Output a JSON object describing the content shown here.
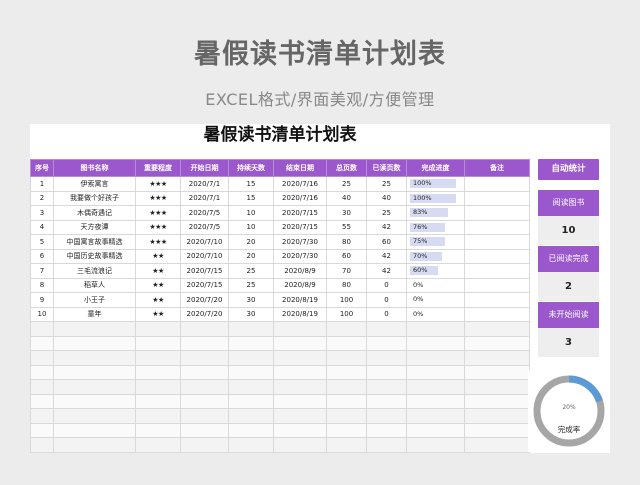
{
  "header": {
    "title": "暑假读书清单计划表",
    "subtitle": "EXCEL格式/界面美观/方便管理"
  },
  "sheet": {
    "title": "暑假读书清单计划表",
    "columns": [
      "序号",
      "图书名称",
      "重要程度",
      "开始日期",
      "持续天数",
      "结束日期",
      "总页数",
      "已读页数",
      "完成进度",
      "备注"
    ],
    "rows": [
      {
        "no": "1",
        "name": "伊索寓言",
        "stars": "★★★",
        "start": "2020/7/1",
        "days": "15",
        "end": "2020/7/16",
        "total": "25",
        "read": "25",
        "progress": "100%",
        "progress_value": 1.0,
        "note": ""
      },
      {
        "no": "2",
        "name": "我要做个好孩子",
        "stars": "★★★",
        "start": "2020/7/1",
        "days": "15",
        "end": "2020/7/16",
        "total": "40",
        "read": "40",
        "progress": "100%",
        "progress_value": 1.0,
        "note": ""
      },
      {
        "no": "3",
        "name": "木偶奇遇记",
        "stars": "★★★",
        "start": "2020/7/5",
        "days": "10",
        "end": "2020/7/15",
        "total": "30",
        "read": "25",
        "progress": "83%",
        "progress_value": 0.83,
        "note": ""
      },
      {
        "no": "4",
        "name": "天方夜谭",
        "stars": "★★★",
        "start": "2020/7/5",
        "days": "10",
        "end": "2020/7/15",
        "total": "55",
        "read": "42",
        "progress": "76%",
        "progress_value": 0.76,
        "note": ""
      },
      {
        "no": "5",
        "name": "中国寓言故事精选",
        "stars": "★★★",
        "start": "2020/7/10",
        "days": "20",
        "end": "2020/7/30",
        "total": "80",
        "read": "60",
        "progress": "75%",
        "progress_value": 0.75,
        "note": ""
      },
      {
        "no": "6",
        "name": "中国历史故事精选",
        "stars": "★★",
        "start": "2020/7/10",
        "days": "20",
        "end": "2020/7/30",
        "total": "60",
        "read": "42",
        "progress": "70%",
        "progress_value": 0.7,
        "note": ""
      },
      {
        "no": "7",
        "name": "三毛流浪记",
        "stars": "★★",
        "start": "2020/7/15",
        "days": "25",
        "end": "2020/8/9",
        "total": "70",
        "read": "42",
        "progress": "60%",
        "progress_value": 0.6,
        "note": ""
      },
      {
        "no": "8",
        "name": "稻草人",
        "stars": "★★",
        "start": "2020/7/15",
        "days": "25",
        "end": "2020/8/9",
        "total": "80",
        "read": "0",
        "progress": "0%",
        "progress_value": 0.0,
        "note": ""
      },
      {
        "no": "9",
        "name": "小王子",
        "stars": "★★",
        "start": "2020/7/20",
        "days": "30",
        "end": "2020/8/19",
        "total": "100",
        "read": "0",
        "progress": "0%",
        "progress_value": 0.0,
        "note": ""
      },
      {
        "no": "10",
        "name": "童年",
        "stars": "★★",
        "start": "2020/7/20",
        "days": "30",
        "end": "2020/8/19",
        "total": "100",
        "read": "0",
        "progress": "0%",
        "progress_value": 0.0,
        "note": ""
      }
    ]
  },
  "stats": {
    "title": "自动统计",
    "books_label": "阅读图书",
    "books_value": "10",
    "done_label": "已阅读完成",
    "done_value": "2",
    "pending_label": "未开始阅读",
    "pending_value": "3"
  },
  "gauge": {
    "percent_text": "20%",
    "label": "完成率",
    "value": 0.2,
    "fill_color": "#5b9bd5",
    "track_color": "#a6a6a6"
  },
  "colors": {
    "accent": "#9b57cc",
    "star": "#e8821e",
    "progress_bar": "#d6dbf2"
  }
}
